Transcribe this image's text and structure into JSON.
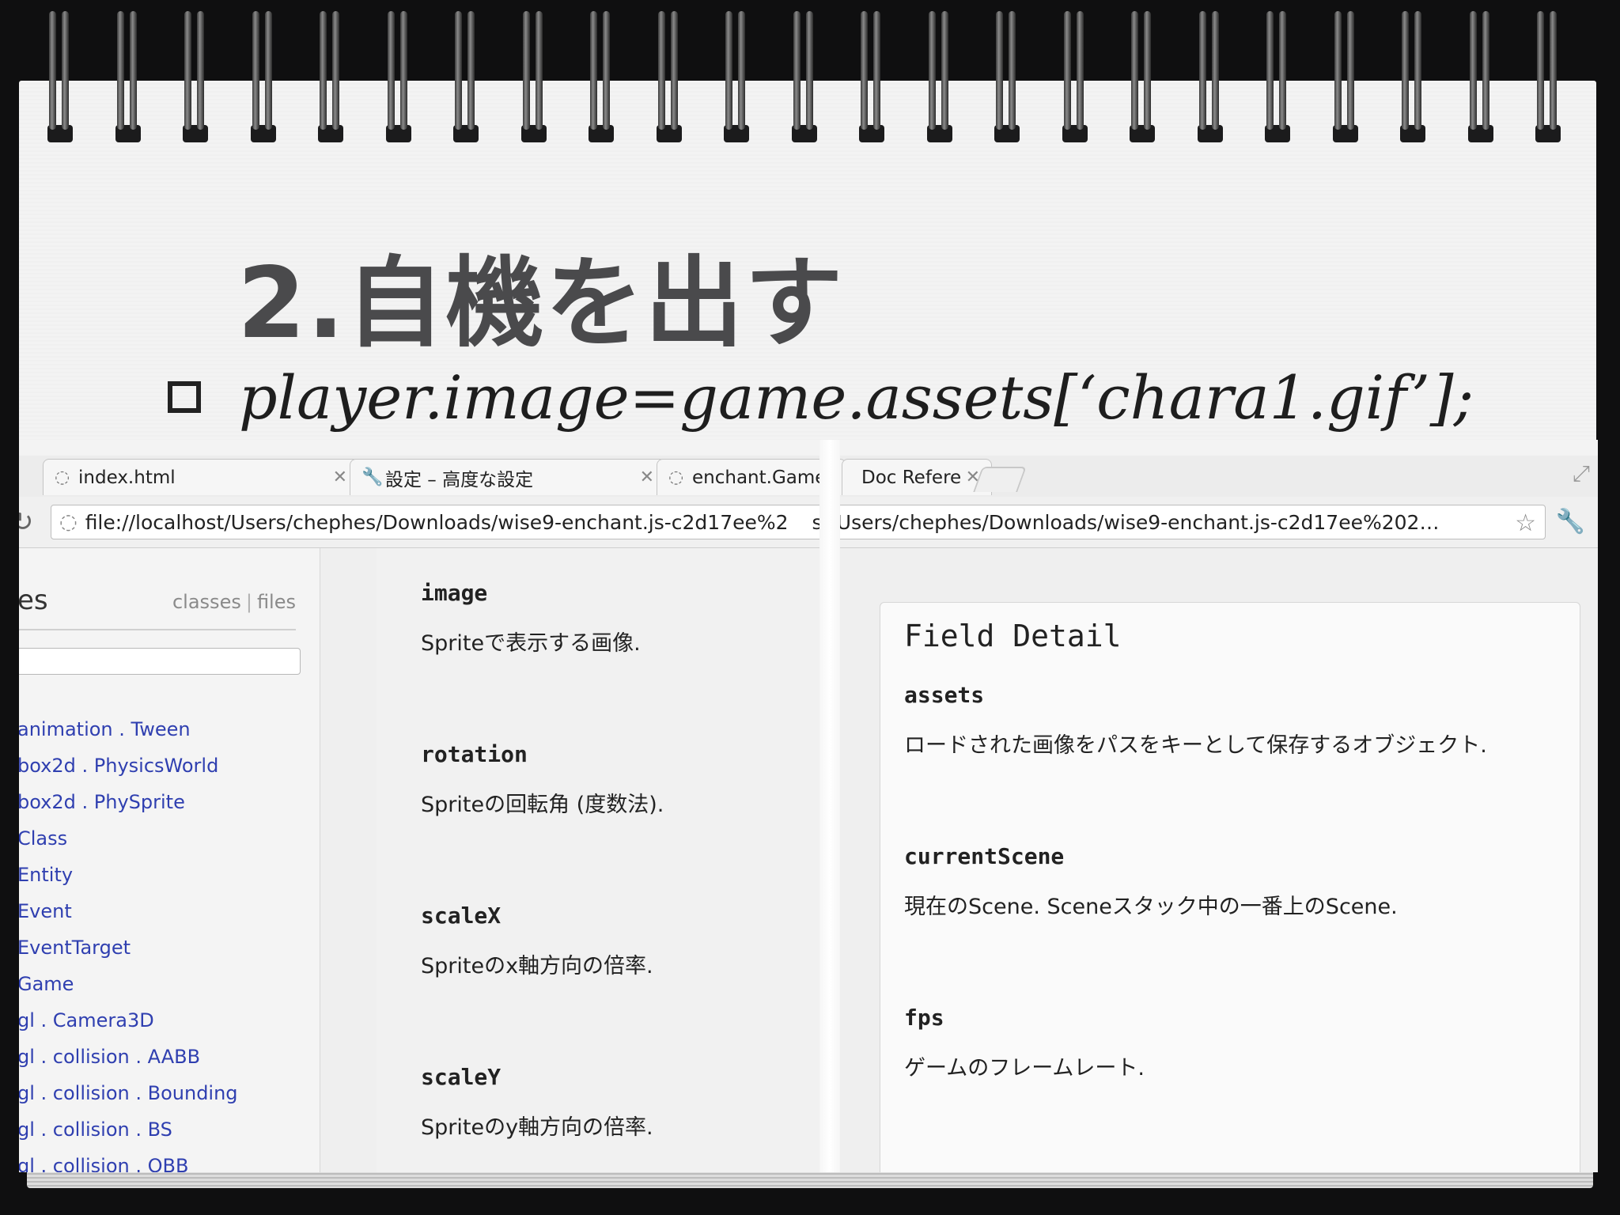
{
  "slide": {
    "title": "2.自機を出す",
    "bullet": "player.image=game.assets[‘chara1.gif’];"
  },
  "browser": {
    "tabs": [
      {
        "label": "index.html",
        "icon": "globe-icon"
      },
      {
        "label": "設定 – 高度な設定",
        "icon": "wrench-icon"
      },
      {
        "label": "enchant.Game",
        "icon": "globe-icon"
      },
      {
        "label": "Doc Refere",
        "icon": ""
      }
    ],
    "url_left": "file://localhost/Users/chephes/Downloads/wise9-enchant.js-c2d17ee%2",
    "url_right": "st/Users/chephes/Downloads/wise9-enchant.js-c2d17ee%202…"
  },
  "sidebar": {
    "heading": "es",
    "switch_classes": "classes",
    "switch_sep": "|",
    "switch_files": "files",
    "items": [
      "animation . Tween",
      "box2d . PhysicsWorld",
      "box2d . PhySprite",
      "Class",
      "Entity",
      "Event",
      "EventTarget",
      "Game",
      "gl . Camera3D",
      "gl . collision . AABB",
      "gl . collision . Bounding",
      "gl . collision . BS",
      "gl . collision . OBB"
    ]
  },
  "fields": [
    {
      "name": "image",
      "desc": "Spriteで表示する画像."
    },
    {
      "name": "rotation",
      "desc": "Spriteの回転角 (度数法)."
    },
    {
      "name": "scaleX",
      "desc": "Spriteのx軸方向の倍率."
    },
    {
      "name": "scaleY",
      "desc": "Spriteのy軸方向の倍率."
    }
  ],
  "detail": {
    "title": "Field Detail",
    "items": [
      {
        "name": "assets",
        "desc": "ロードされた画像をパスをキーとして保存するオブジェクト."
      },
      {
        "name": "currentScene",
        "desc": "現在のScene. Sceneスタック中の一番上のScene."
      },
      {
        "name": "fps",
        "desc": "ゲームのフレームレート."
      }
    ]
  }
}
